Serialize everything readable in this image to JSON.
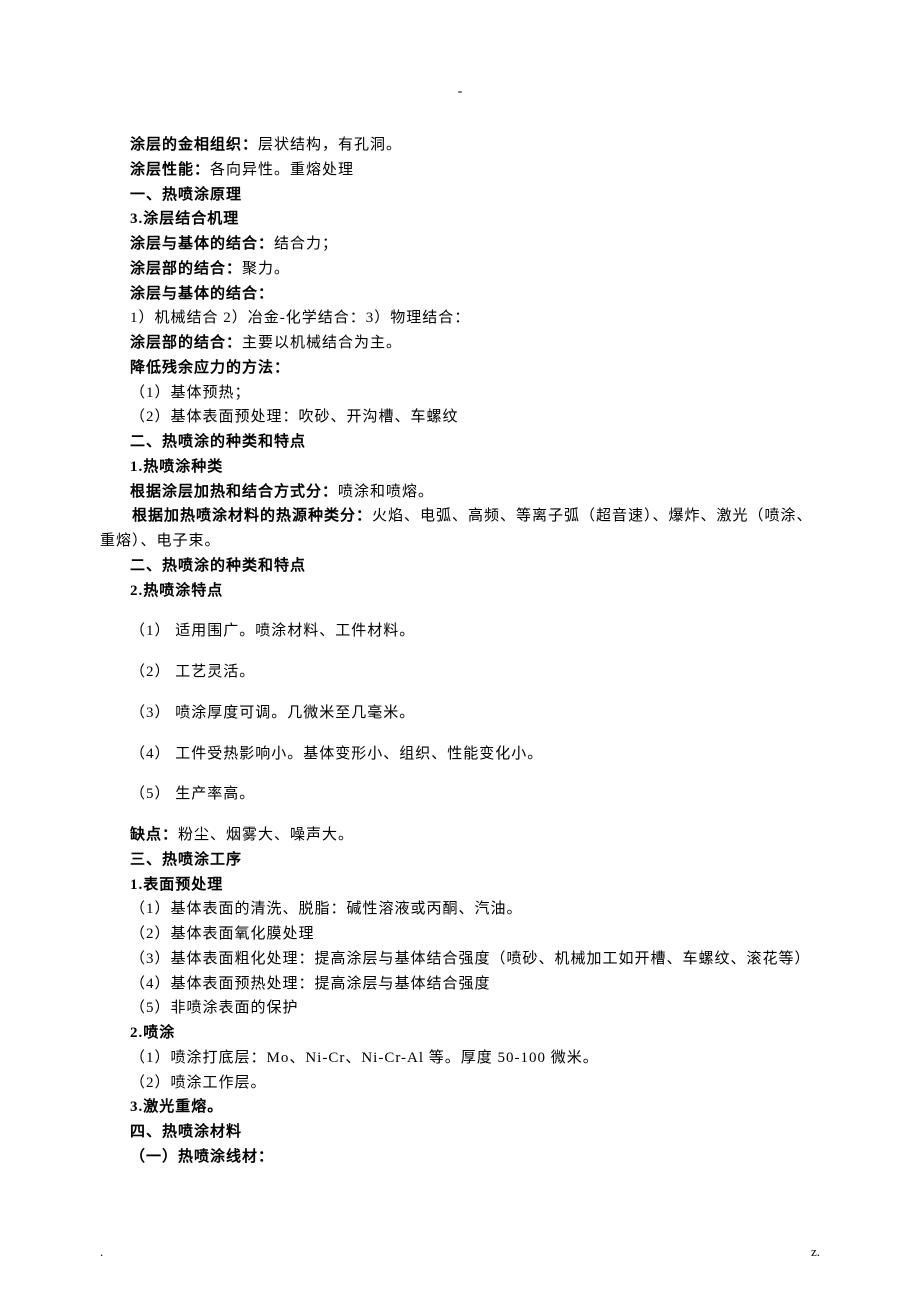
{
  "header": {
    "dash": "-"
  },
  "content": {
    "l1": {
      "label": "涂层的金相组织：",
      "text": "层状结构，有孔洞。"
    },
    "l2": {
      "label": "涂层性能：",
      "text": "各向异性。重熔处理"
    },
    "l3": "一、热喷涂原理",
    "l4": "3.涂层结合机理",
    "l5": {
      "label": "涂层与基体的结合：",
      "text": "结合力；"
    },
    "l6": {
      "label": "涂层部的结合：",
      "text": "聚力。"
    },
    "l7": "涂层与基体的结合：",
    "l8": "1）机械结合    2）冶金-化学结合：3）物理结合：",
    "l9": {
      "label": "涂层部的结合：",
      "text": "主要以机械结合为主。"
    },
    "l10": "降低残余应力的方法：",
    "l11": "（1）基体预热；",
    "l12": "（2）基体表面预处理：吹砂、开沟槽、车螺纹",
    "l13": "二、热喷涂的种类和特点",
    "l14": "1.热喷涂种类",
    "l15": {
      "label": "根据涂层加热和结合方式分：",
      "text": "喷涂和喷熔。"
    },
    "l16": {
      "label": "根据加热喷涂材料的热源种类分：",
      "text": "火焰、电弧、高频、等离子弧（超音速）、爆炸、激光（喷涂、重熔）、电子束。"
    },
    "l17": "二、热喷涂的种类和特点",
    "l18": "2.热喷涂特点",
    "n1": "（1）  适用围广。喷涂材料、工件材料。",
    "n2": "（2）  工艺灵活。",
    "n3": "（3）  喷涂厚度可调。几微米至几毫米。",
    "n4": "（4） 工件受热影响小。基体变形小、组织、性能变化小。",
    "n5": "（5）  生产率高。",
    "l19": {
      "label": "缺点：",
      "text": "粉尘、烟雾大、噪声大。"
    },
    "l20": "三、热喷涂工序",
    "l21": "1.表面预处理",
    "l22": "（1）基体表面的清洗、脱脂：碱性溶液或丙酮、汽油。",
    "l23": "（2）基体表面氧化膜处理",
    "l24": "（3）基体表面粗化处理：提高涂层与基体结合强度（喷砂、机械加工如开槽、车螺纹、滚花等）",
    "l25": "（4）基体表面预热处理：提高涂层与基体结合强度",
    "l26": "（5）非喷涂表面的保护",
    "l27": "2.喷涂",
    "l28": "（1）喷涂打底层：Mo、Ni-Cr、Ni-Cr-Al 等。厚度 50-100 微米。",
    "l29": "（2）喷涂工作层。",
    "l30": "3.激光重熔。",
    "l31": "四、热喷涂材料",
    "l32": "（一）热喷涂线材："
  },
  "footer": {
    "left": ".",
    "right": "z."
  }
}
